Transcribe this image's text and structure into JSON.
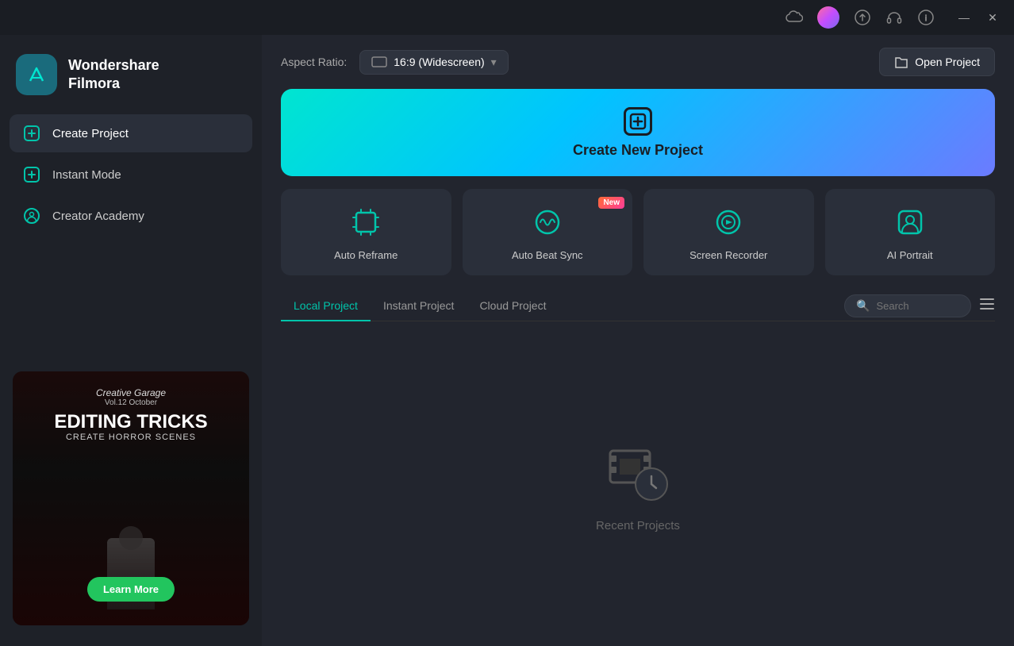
{
  "app": {
    "name": "Wondershare",
    "subtitle": "Filmora"
  },
  "titlebar": {
    "icons": [
      "cloud",
      "avatar",
      "upload",
      "headphones",
      "info"
    ]
  },
  "sidebar": {
    "nav_items": [
      {
        "id": "create-project",
        "label": "Create Project",
        "active": true
      },
      {
        "id": "instant-mode",
        "label": "Instant Mode",
        "active": false
      },
      {
        "id": "creator-academy",
        "label": "Creator Academy",
        "active": false
      }
    ]
  },
  "promo": {
    "small_title": "Creative Garage",
    "small_subtitle": "Vol.12 October",
    "main_title": "EDITING TRICKS",
    "sub_title": "CREATE HORROR SCENES",
    "btn_label": "Learn More"
  },
  "topbar": {
    "aspect_label": "Aspect Ratio:",
    "aspect_value": "16:9 (Widescreen)",
    "open_project_label": "Open Project"
  },
  "banner": {
    "label": "Create New Project"
  },
  "feature_cards": [
    {
      "id": "auto-reframe",
      "label": "Auto Reframe",
      "new": false
    },
    {
      "id": "auto-beat-sync",
      "label": "Auto Beat Sync",
      "new": true
    },
    {
      "id": "screen-recorder",
      "label": "Screen Recorder",
      "new": false
    },
    {
      "id": "ai-portrait",
      "label": "AI Portrait",
      "new": false
    }
  ],
  "tabs": {
    "items": [
      {
        "id": "local-project",
        "label": "Local Project",
        "active": true
      },
      {
        "id": "instant-project",
        "label": "Instant Project",
        "active": false
      },
      {
        "id": "cloud-project",
        "label": "Cloud Project",
        "active": false
      }
    ],
    "search_placeholder": "Search"
  },
  "empty_state": {
    "label": "Recent Projects"
  }
}
